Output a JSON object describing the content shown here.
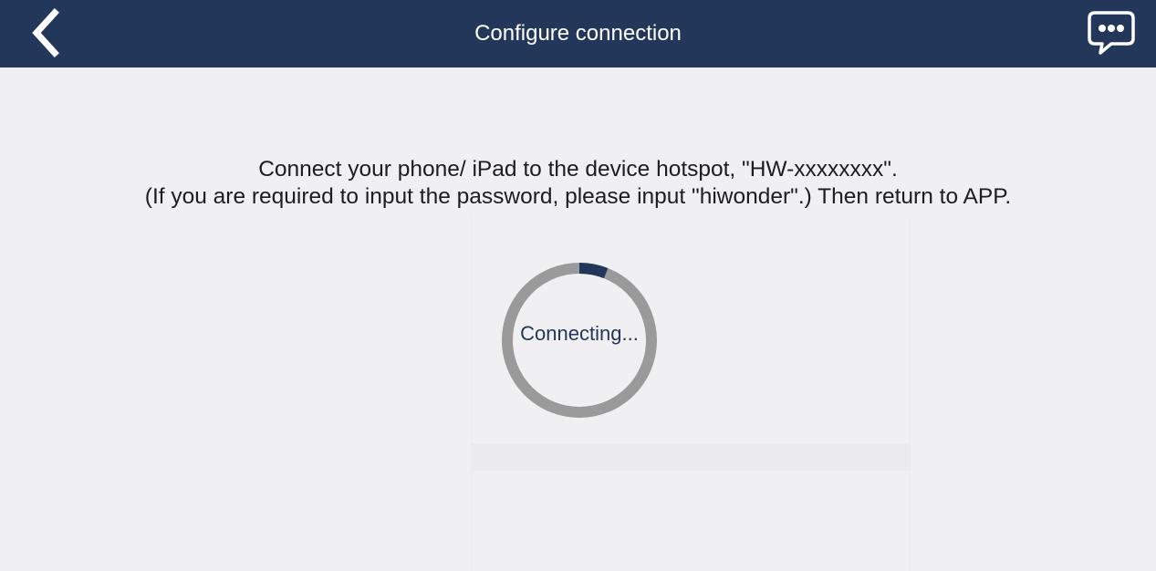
{
  "header": {
    "title": "Configure connection",
    "back_icon": "chevron-left-icon",
    "chat_icon": "chat-bubble-icon",
    "background_color": "#23375a"
  },
  "instructions": {
    "line1": "Connect your phone/ iPad to the device hotspot, \"HW-xxxxxxxx\".",
    "line2": "(If you are required to input the password, please input \"hiwonder\".) Then return to APP."
  },
  "connection": {
    "status_text": "Connecting...",
    "progress_fraction": 0.06,
    "progress_color": "#23375a",
    "track_color": "#9a9a9a"
  }
}
